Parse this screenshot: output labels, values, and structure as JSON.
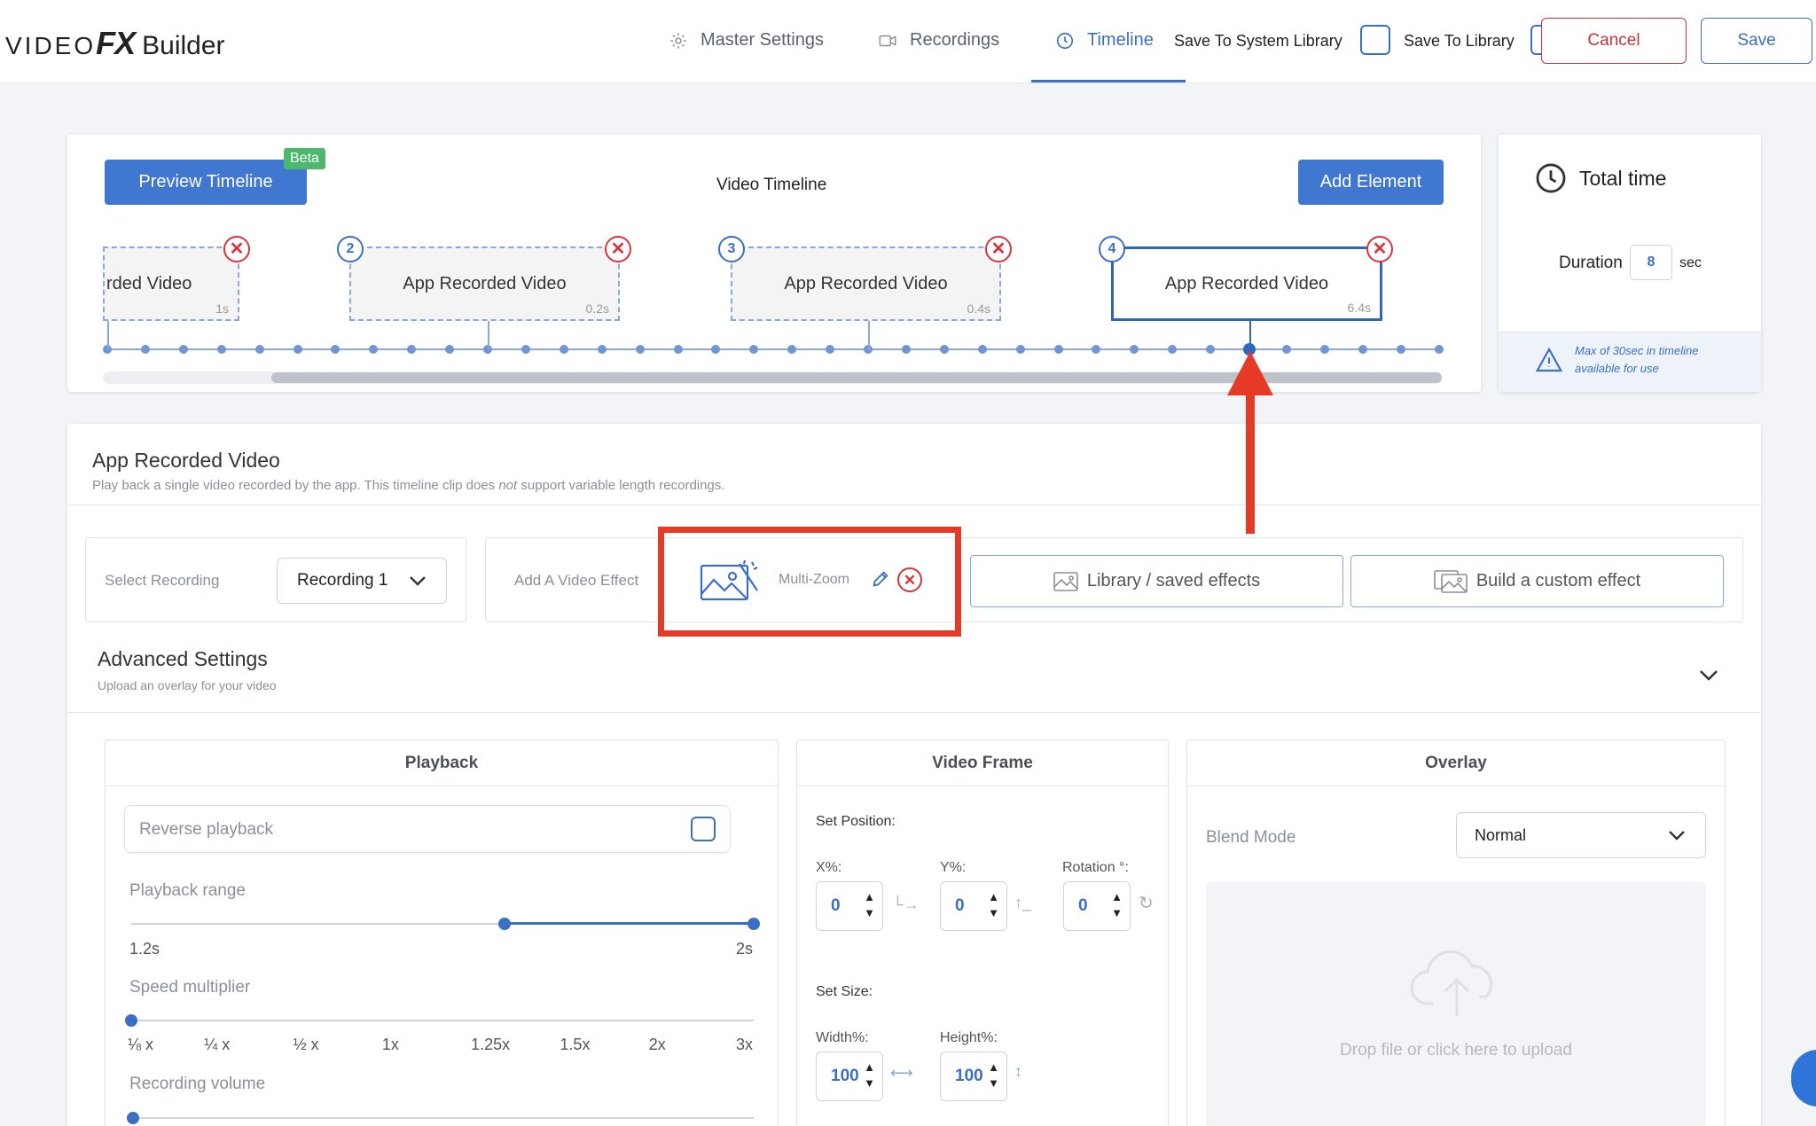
{
  "header": {
    "logo_video": "VIDEO",
    "logo_fx": "FX",
    "logo_builder": "Builder",
    "nav": [
      {
        "label": "Master Settings",
        "icon": "gear-icon"
      },
      {
        "label": "Recordings",
        "icon": "video-camera-icon"
      },
      {
        "label": "Timeline",
        "icon": "clock-icon",
        "active": true
      }
    ],
    "save_system_library": "Save To System Library",
    "save_library": "Save To Library",
    "cancel": "Cancel",
    "save": "Save"
  },
  "timeline": {
    "preview_button": "Preview Timeline",
    "beta": "Beta",
    "title": "Video Timeline",
    "add_element": "Add Element",
    "clips": [
      {
        "num": "",
        "label": "rded Video",
        "duration": "1s"
      },
      {
        "num": "2",
        "label": "App Recorded Video",
        "duration": "0.2s"
      },
      {
        "num": "3",
        "label": "App Recorded Video",
        "duration": "0.4s"
      },
      {
        "num": "4",
        "label": "App Recorded Video",
        "duration": "6.4s",
        "selected": true
      }
    ]
  },
  "total": {
    "title": "Total time",
    "duration_label": "Duration",
    "duration_value": "8",
    "unit": "sec",
    "warning": "Max of 30sec in timeline available for use"
  },
  "clip_panel": {
    "title": "App Recorded Video",
    "desc_before": "Play back a single video recorded by the app. This timeline clip does ",
    "desc_em": "not",
    "desc_after": " support variable length recordings.",
    "select_recording_label": "Select Recording",
    "recording_value": "Recording 1",
    "add_effect_label": "Add A Video Effect",
    "effect_name": "Multi-Zoom",
    "library_button": "Library / saved effects",
    "custom_button": "Build a custom effect",
    "advanced_title": "Advanced Settings",
    "advanced_desc": "Upload an overlay for your video"
  },
  "playback": {
    "title": "Playback",
    "reverse": "Reverse playback",
    "range_label": "Playback range",
    "range_min": "1.2s",
    "range_max": "2s",
    "range_start_fraction": 0.6,
    "range_end_fraction": 1.0,
    "speed_label": "Speed multiplier",
    "speed_options": [
      "⅛ x",
      "¼ x",
      "½ x",
      "1x",
      "1.25x",
      "1.5x",
      "2x",
      "3x"
    ],
    "speed_selected_index": 0,
    "volume_label": "Recording volume"
  },
  "video_frame": {
    "title": "Video Frame",
    "set_position": "Set Position:",
    "x_label": "X%:",
    "x_value": "0",
    "y_label": "Y%:",
    "y_value": "0",
    "rotation_label": "Rotation °:",
    "rotation_value": "0",
    "set_size": "Set Size:",
    "width_label": "Width%:",
    "width_value": "100",
    "height_label": "Height%:",
    "height_value": "100"
  },
  "overlay": {
    "title": "Overlay",
    "blend_label": "Blend Mode",
    "blend_value": "Normal",
    "upload_text": "Drop file or click here to upload"
  },
  "colors": {
    "accent": "#3a6fc4",
    "danger": "#d9343b",
    "annotation": "#e53a25",
    "beta": "#4bb86a"
  }
}
